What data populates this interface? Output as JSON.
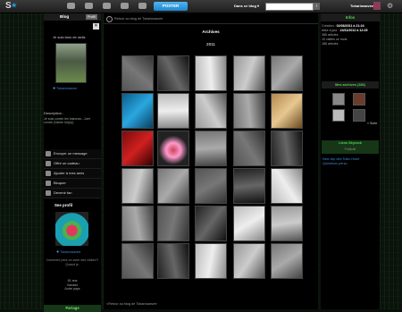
{
  "topbar": {
    "logo": "S",
    "post_label": "POSTER",
    "search_scope": "Dans ce blog",
    "search_placeholder": "",
    "search_button": "›",
    "username": "Tokariowavee"
  },
  "left": {
    "tab_blog": "Blog",
    "tab_profil": "Profil",
    "fans_text": "Je suis fans de radis",
    "blog_name": "Tokariowavee",
    "description_label": "Description :",
    "description_text": "Je suis contre les fusionss...Juet contre (Vache toi)(s))",
    "actions": [
      "Envoyer un message",
      "Offrir un cadeau",
      "Ajouter à mes amis",
      "Bloquer",
      "Devenir fan"
    ],
    "see_profile": "See profil",
    "profile_name": "Tokariowavee",
    "profile_question": "Comment peut-on avoir des visites?! Quand je.",
    "profile_info": "81 ans\nXanado\nAutre pays",
    "partage": "Partage"
  },
  "main": {
    "back_top": "Retour au blog de Tokariowavee",
    "title": "Archives",
    "year": "2011",
    "back_bottom": "Retour au blog de Tokariowavee"
  },
  "right": {
    "info_title": "Infos",
    "creation_label": "Création :",
    "creation_value": "02/08/2011 à 21:24",
    "update_label": "Mise à jour :",
    "update_value": "24/11/2012 à 12:25",
    "articles": "385 articles",
    "comments": "10 visites ce mois",
    "visits": "186 articles",
    "archives_label": "Mes archives (186)",
    "suite": "» Suite",
    "sky_title": "Liens Skyrock",
    "sky_sub": "Publicité",
    "links": [
      "New clip des Tokio Hotel",
      "Questions perso"
    ]
  },
  "colors": {
    "accent_green": "#4fd94f",
    "link_blue": "#3b8ad9",
    "post_blue": "#1e86cf"
  }
}
